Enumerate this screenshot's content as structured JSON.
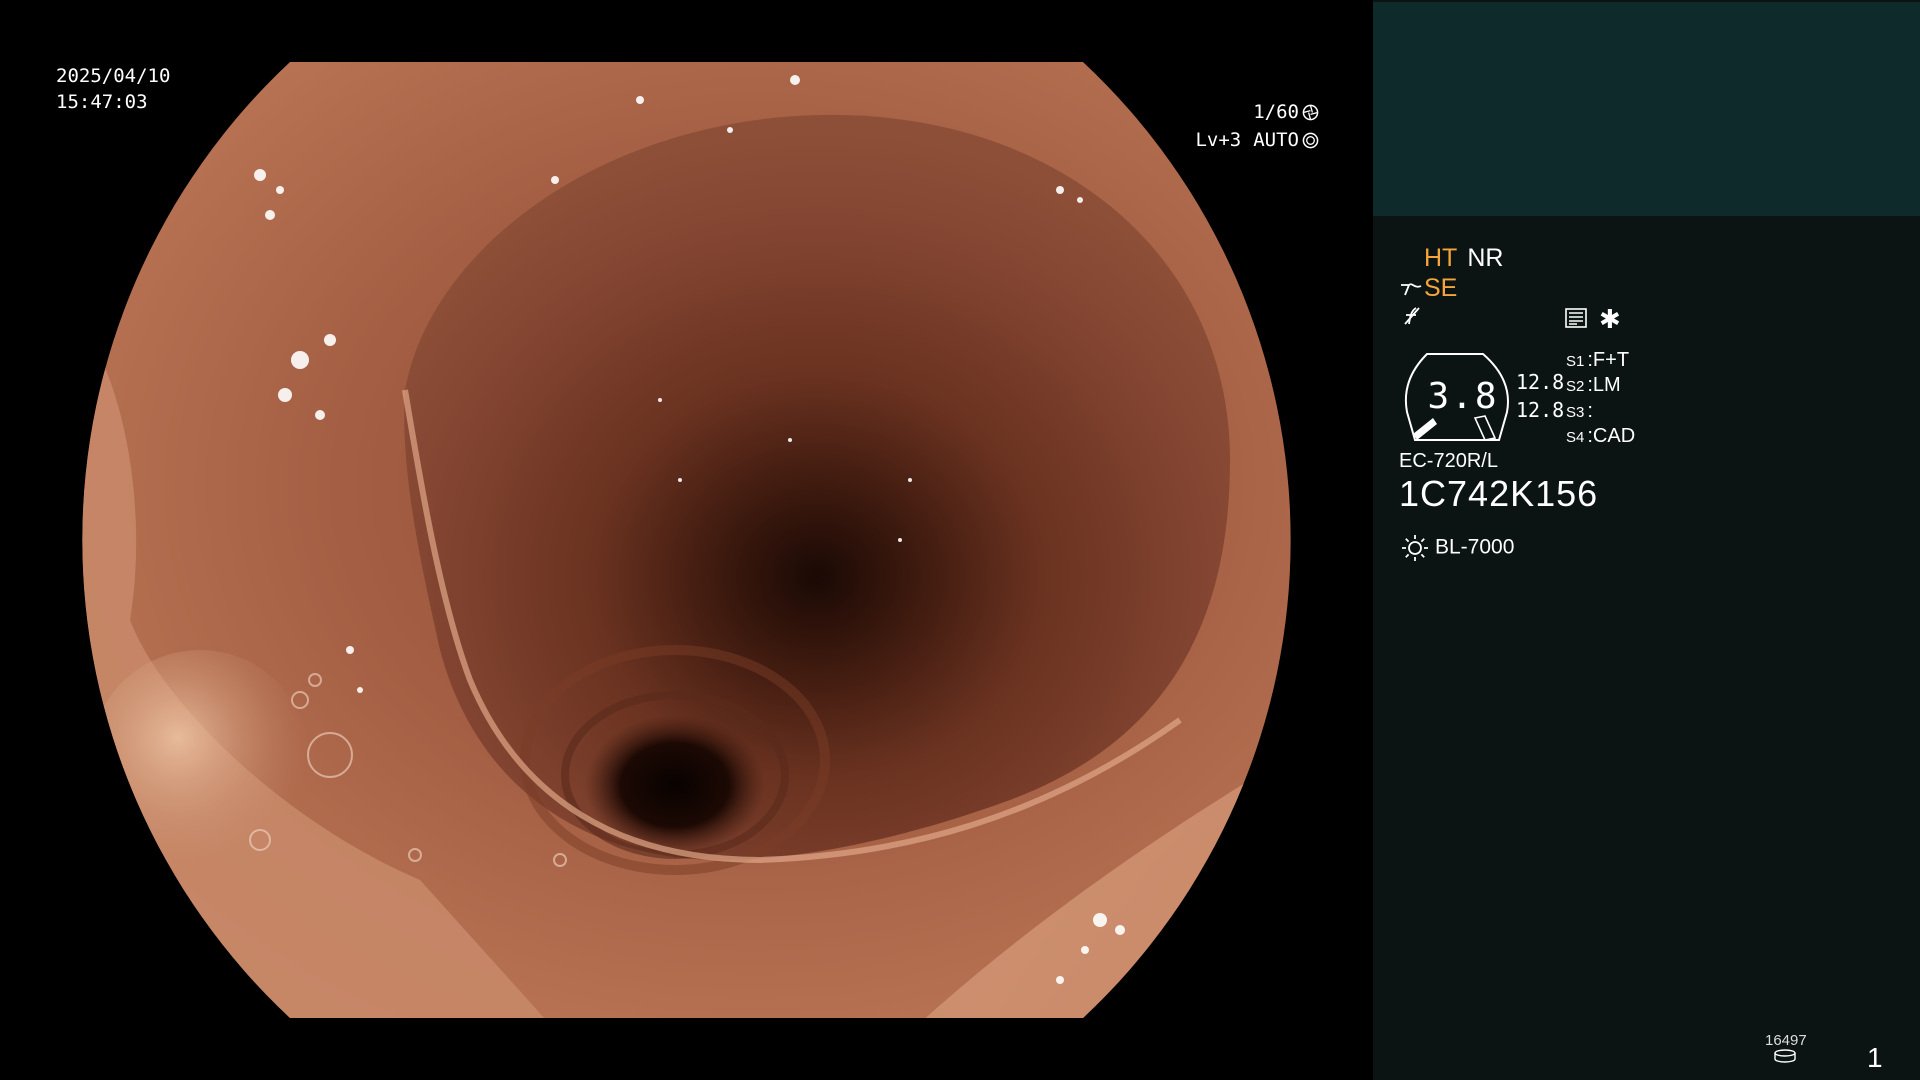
{
  "overlay": {
    "date": "2025/04/10",
    "time": "15:47:03",
    "shutter": "1/60",
    "shutter_icon": "aperture-icon",
    "level": "Lv+3",
    "mode": "AUTO",
    "mode_icon": "iris-icon"
  },
  "panel": {
    "ht_label": "HT",
    "nr_label": "NR",
    "se_label": "SE",
    "highlight_color": "#f5a53a",
    "top_block_color": "#0e2a2b",
    "panel_color": "#0b1313",
    "gauge": {
      "value": "3.8",
      "readout_1": "12.8",
      "readout_2": "12.8"
    },
    "switches": [
      {
        "key": "S1",
        "value": "F+T"
      },
      {
        "key": "S2",
        "value": "LM"
      },
      {
        "key": "S3",
        "value": ""
      },
      {
        "key": "S4",
        "value": "CAD"
      }
    ],
    "scope_model": "EC-720R/L",
    "serial": "1C742K156",
    "light_source": "BL-7000",
    "counter": "16497",
    "page_number": "1"
  }
}
